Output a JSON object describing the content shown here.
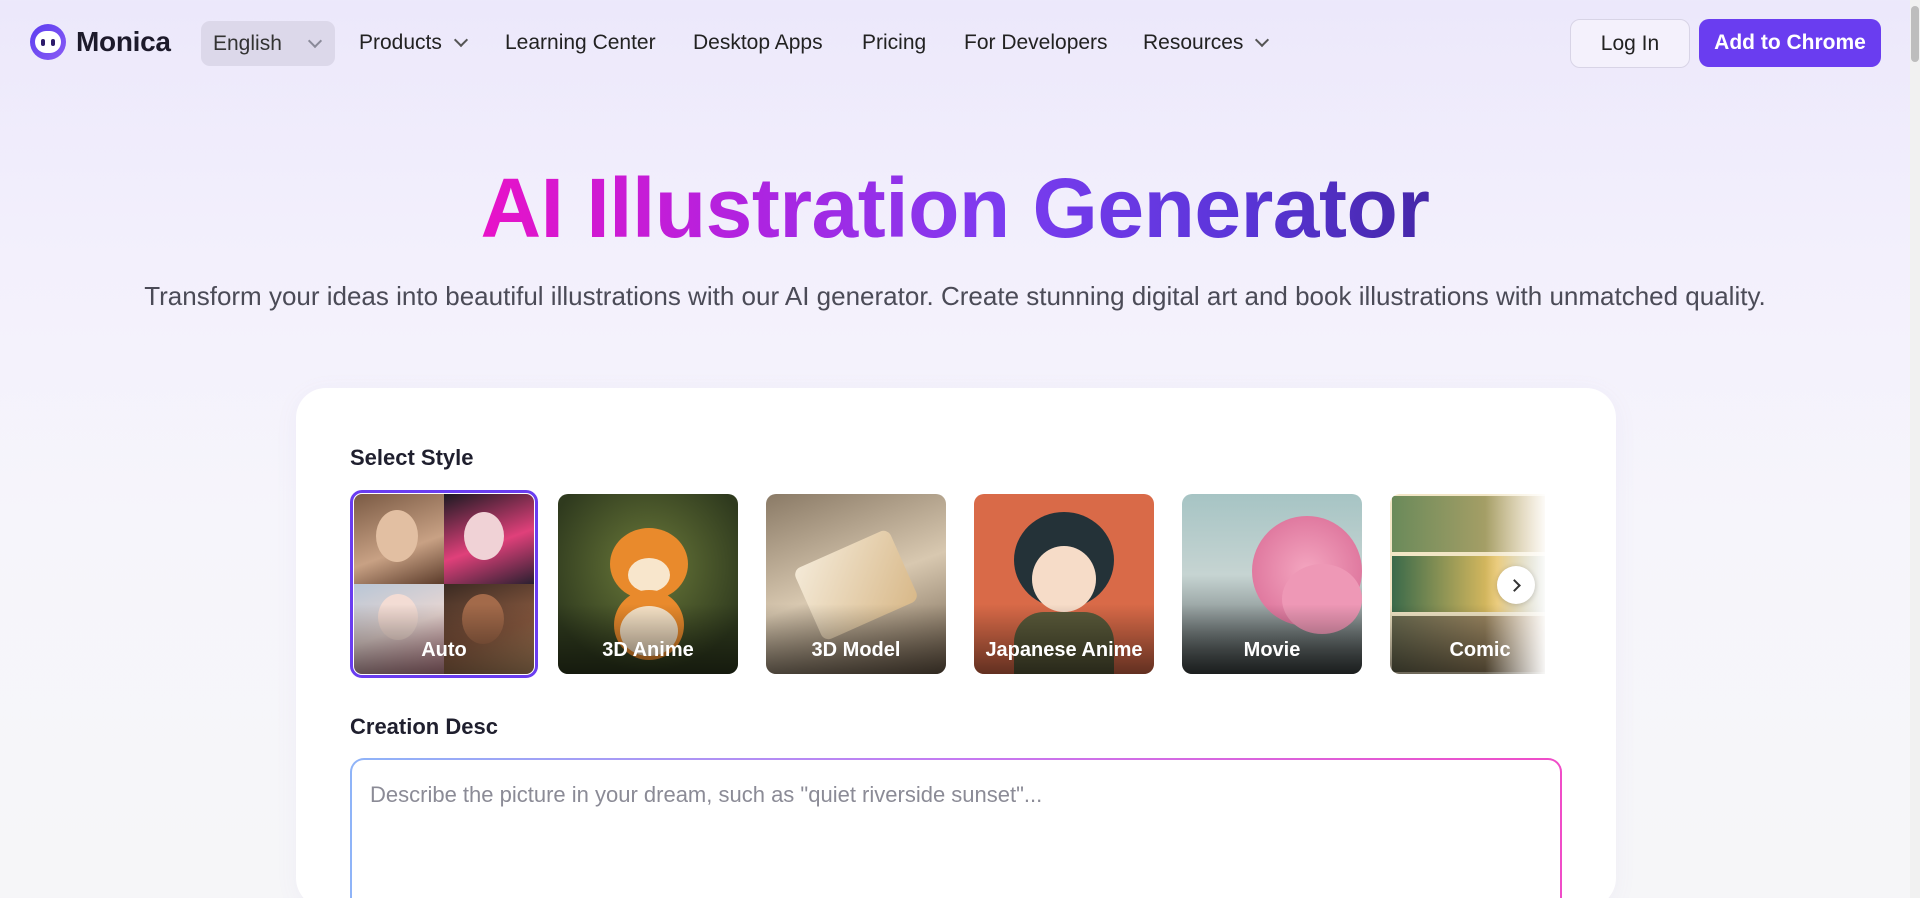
{
  "nav": {
    "logo_text": "Monica",
    "language": "English",
    "items": [
      {
        "label": "Products",
        "has_dropdown": true
      },
      {
        "label": "Learning Center",
        "has_dropdown": false
      },
      {
        "label": "Desktop Apps",
        "has_dropdown": false
      },
      {
        "label": "Pricing",
        "has_dropdown": false
      },
      {
        "label": "For Developers",
        "has_dropdown": false
      },
      {
        "label": "Resources",
        "has_dropdown": true
      }
    ],
    "login_label": "Log In",
    "cta_label": "Add to Chrome"
  },
  "hero": {
    "title": "AI Illustration Generator",
    "subtitle": "Transform your ideas into beautiful illustrations with our AI generator. Create stunning digital art and book illustrations with unmatched quality."
  },
  "form": {
    "style_label": "Select Style",
    "styles": [
      {
        "label": "Auto",
        "selected": true
      },
      {
        "label": "3D Anime",
        "selected": false
      },
      {
        "label": "3D Model",
        "selected": false
      },
      {
        "label": "Japanese Anime",
        "selected": false
      },
      {
        "label": "Movie",
        "selected": false
      },
      {
        "label": "Comic",
        "selected": false
      }
    ],
    "desc_label": "Creation Desc",
    "desc_placeholder": "Describe the picture in your dream, such as \"quiet riverside sunset\"...",
    "desc_value": ""
  },
  "colors": {
    "accent": "#6a3df0",
    "title_gradient_start": "#e812c8",
    "title_gradient_end": "#4527a8"
  },
  "icons": [
    "monica-logo-icon",
    "chevron-down-icon",
    "chevron-right-icon"
  ]
}
